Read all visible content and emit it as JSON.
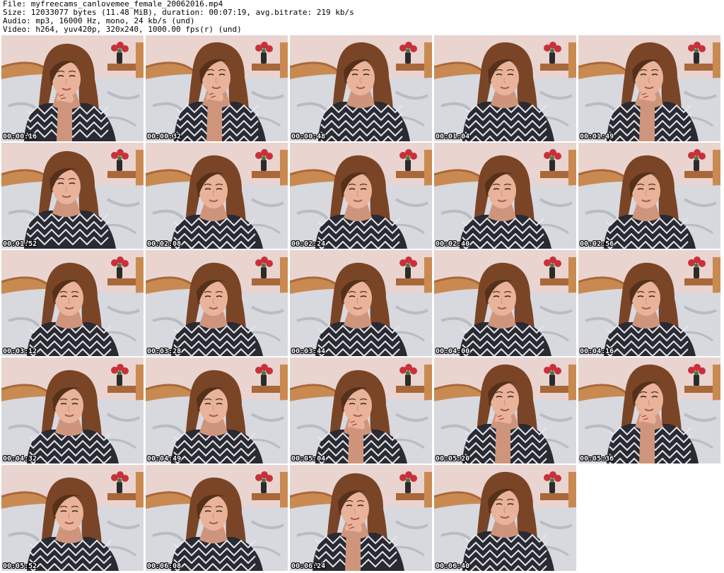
{
  "header": {
    "file_line": "File: myfreecams_canlovemee_female_20062016.mp4",
    "size_line": "Size: 12033077 bytes (11.48 MiB), duration: 00:07:19, avg.bitrate: 219 kb/s",
    "audio_line": "Audio: mp3, 16000 Hz, mono, 24 kb/s (und)",
    "video_line": "Video: h264, yuv420p, 320x240, 1000.00 fps(r) (und)"
  },
  "thumbnails": [
    {
      "timestamp": "00:00:16",
      "pose": "hand-chin",
      "head": "tilt-left"
    },
    {
      "timestamp": "00:00:32",
      "pose": "hand-chin",
      "head": "center"
    },
    {
      "timestamp": "00:00:48",
      "pose": "lean",
      "head": "center"
    },
    {
      "timestamp": "00:01:04",
      "pose": "lean",
      "head": "center"
    },
    {
      "timestamp": "00:01:49",
      "pose": "hand-chin",
      "head": "center"
    },
    {
      "timestamp": "00:01:52",
      "pose": "lean",
      "head": "tilt-left"
    },
    {
      "timestamp": "00:02:08",
      "pose": "lean",
      "head": "down"
    },
    {
      "timestamp": "00:02:24",
      "pose": "lean",
      "head": "down"
    },
    {
      "timestamp": "00:02:40",
      "pose": "lean",
      "head": "down"
    },
    {
      "timestamp": "00:02:56",
      "pose": "lean",
      "head": "down"
    },
    {
      "timestamp": "00:03:12",
      "pose": "lean",
      "head": "down"
    },
    {
      "timestamp": "00:03:28",
      "pose": "lean",
      "head": "down"
    },
    {
      "timestamp": "00:03:44",
      "pose": "lean",
      "head": "down"
    },
    {
      "timestamp": "00:04:00",
      "pose": "lean",
      "head": "down"
    },
    {
      "timestamp": "00:04:16",
      "pose": "lean",
      "head": "down"
    },
    {
      "timestamp": "00:04:32",
      "pose": "lean",
      "head": "down"
    },
    {
      "timestamp": "00:04:49",
      "pose": "lean",
      "head": "down"
    },
    {
      "timestamp": "00:05:04",
      "pose": "hand-chin",
      "head": "down"
    },
    {
      "timestamp": "00:05:20",
      "pose": "hand-chin",
      "head": "center"
    },
    {
      "timestamp": "00:05:36",
      "pose": "hand-chin",
      "head": "center"
    },
    {
      "timestamp": "00:05:52",
      "pose": "lean",
      "head": "down"
    },
    {
      "timestamp": "00:06:08",
      "pose": "lean",
      "head": "down"
    },
    {
      "timestamp": "00:06:24",
      "pose": "hand-chin",
      "head": "tilt-left"
    },
    {
      "timestamp": "00:06:40",
      "pose": "lean",
      "head": "center"
    }
  ],
  "colors": {
    "wall": "#e9d4d0",
    "headboard": "#c98a52",
    "headboard_dark": "#a8683a",
    "sheet": "#d7d9de",
    "sheet_shadow": "#b9bcc4",
    "hair": "#7a4526",
    "hair_dark": "#55301a",
    "skin": "#e8b39a",
    "skin_shadow": "#cf957c",
    "top_dark": "#2a2a33",
    "top_light": "#e7e7ee",
    "flowers": "#c8303c",
    "vase": "#2b2b2b",
    "timestamp_text": "#ffffff"
  }
}
